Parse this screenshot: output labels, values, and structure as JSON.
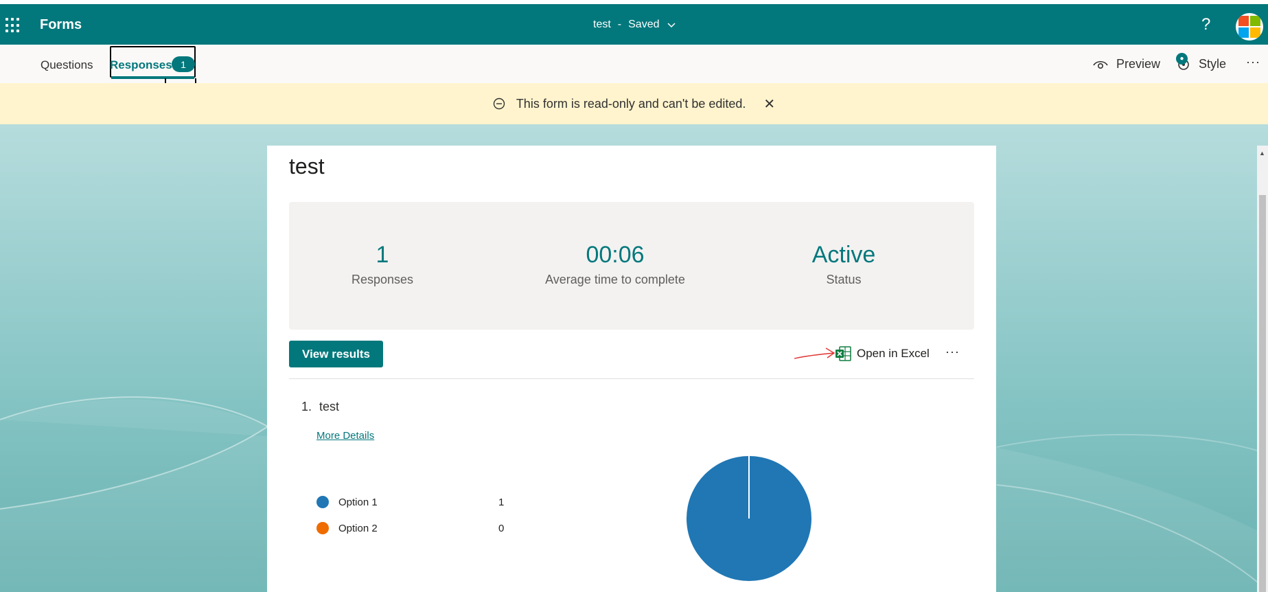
{
  "app": {
    "name": "Forms",
    "doc_title": "test",
    "separator": "-",
    "save_state": "Saved",
    "help": "?"
  },
  "tabs": {
    "questions": "Questions",
    "responses": "Responses",
    "responses_count": "1"
  },
  "toolbar": {
    "preview": "Preview",
    "style": "Style",
    "more": "···"
  },
  "banner": {
    "message": "This form is read-only and can't be edited."
  },
  "form": {
    "title": "test",
    "stats": [
      {
        "value": "1",
        "label": "Responses"
      },
      {
        "value": "00:06",
        "label": "Average time to complete"
      },
      {
        "value": "Active",
        "label": "Status"
      }
    ],
    "view_results": "View results",
    "open_in_excel": "Open in Excel",
    "more": "···"
  },
  "question": {
    "number": "1.",
    "title": "test",
    "more_details": "More Details",
    "options": [
      {
        "label": "Option 1",
        "count": "1",
        "color": "#2077b4"
      },
      {
        "label": "Option 2",
        "count": "0",
        "color": "#ef6c00"
      }
    ]
  },
  "colors": {
    "brand": "#03787c",
    "banner": "#fff4ce",
    "annotation_arrow": "#e03131"
  }
}
